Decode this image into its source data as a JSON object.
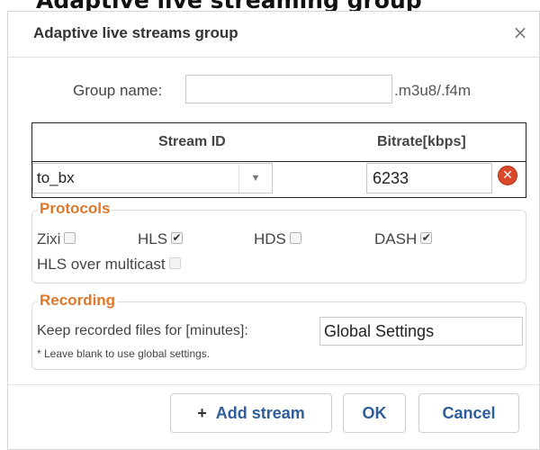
{
  "background_text": "Adaptive live streaming group",
  "dialog": {
    "title": "Adaptive live streams group",
    "close_glyph": "×"
  },
  "group_name": {
    "label": "Group name:",
    "value": "",
    "suffix": ".m3u8/.f4m"
  },
  "streams_table": {
    "columns": [
      "Stream ID",
      "Bitrate[kbps]"
    ],
    "rows": [
      {
        "stream_id": "to_bx",
        "bitrate": "6233"
      }
    ]
  },
  "protocols": {
    "legend": "Protocols",
    "items": [
      {
        "label": "Zixi",
        "checked": false
      },
      {
        "label": "HLS",
        "checked": true
      },
      {
        "label": "HDS",
        "checked": false
      },
      {
        "label": "DASH",
        "checked": true
      },
      {
        "label": "HLS over multicast",
        "checked": false,
        "disabled": true
      }
    ]
  },
  "recording": {
    "legend": "Recording",
    "label": "Keep recorded files for [minutes]:",
    "value": "Global Settings",
    "note": "* Leave blank to use global settings."
  },
  "buttons": {
    "add_stream_icon": "+",
    "add_stream": "Add stream",
    "ok": "OK",
    "cancel": "Cancel"
  },
  "icons": {
    "dropdown": "chevron-down-icon",
    "remove": "remove-circle-icon",
    "close": "close-icon"
  },
  "colors": {
    "legend": "#e0782a",
    "button_text": "#2f5d9a",
    "remove_icon": "#d9492a"
  }
}
